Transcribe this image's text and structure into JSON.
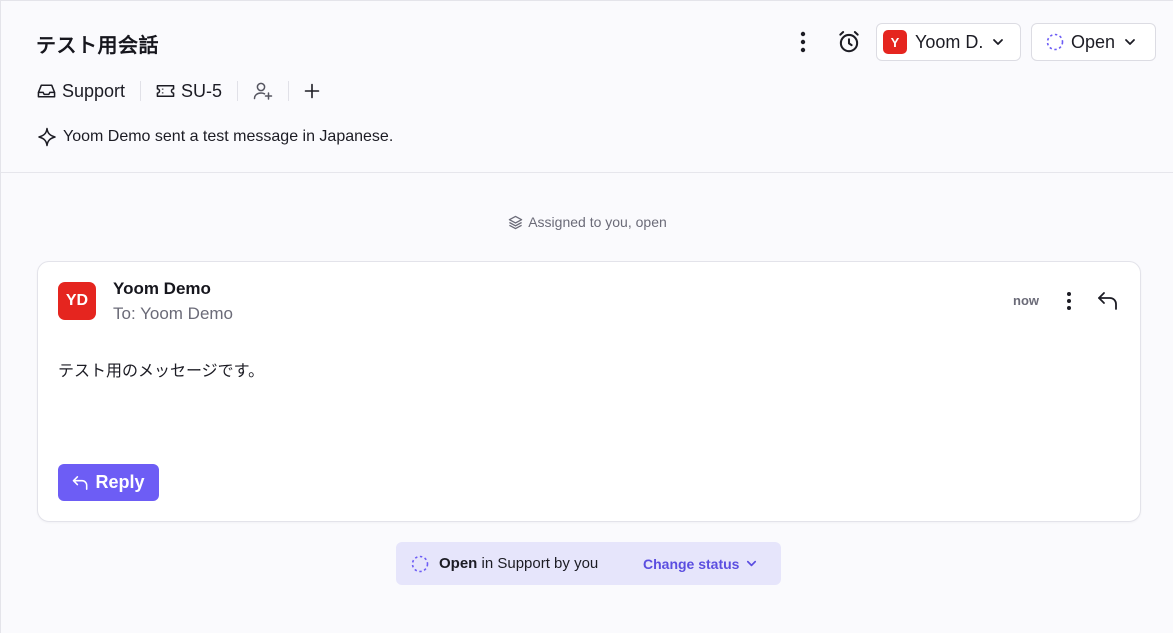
{
  "header": {
    "title": "テスト用会話",
    "assignee": {
      "initial": "Y",
      "name": "Yoom D."
    },
    "status": {
      "label": "Open"
    }
  },
  "meta": {
    "inbox": "Support",
    "ticket_id": "SU-5"
  },
  "summary": "Yoom Demo sent a test message in Japanese.",
  "timeline": {
    "assigned_note": "Assigned to you, open"
  },
  "message": {
    "avatar_initials": "YD",
    "sender": "Yoom Demo",
    "recipient": "To: Yoom Demo",
    "time": "now",
    "body": "テスト用のメッセージです。",
    "reply_label": "Reply"
  },
  "status_bar": {
    "status": "Open",
    "context": "in Support by you",
    "change_label": "Change status"
  },
  "colors": {
    "accent": "#6d5df5",
    "avatar": "#e5251f",
    "status_bar_bg": "#e6e5fb",
    "change_status_text": "#5b4ee0"
  }
}
